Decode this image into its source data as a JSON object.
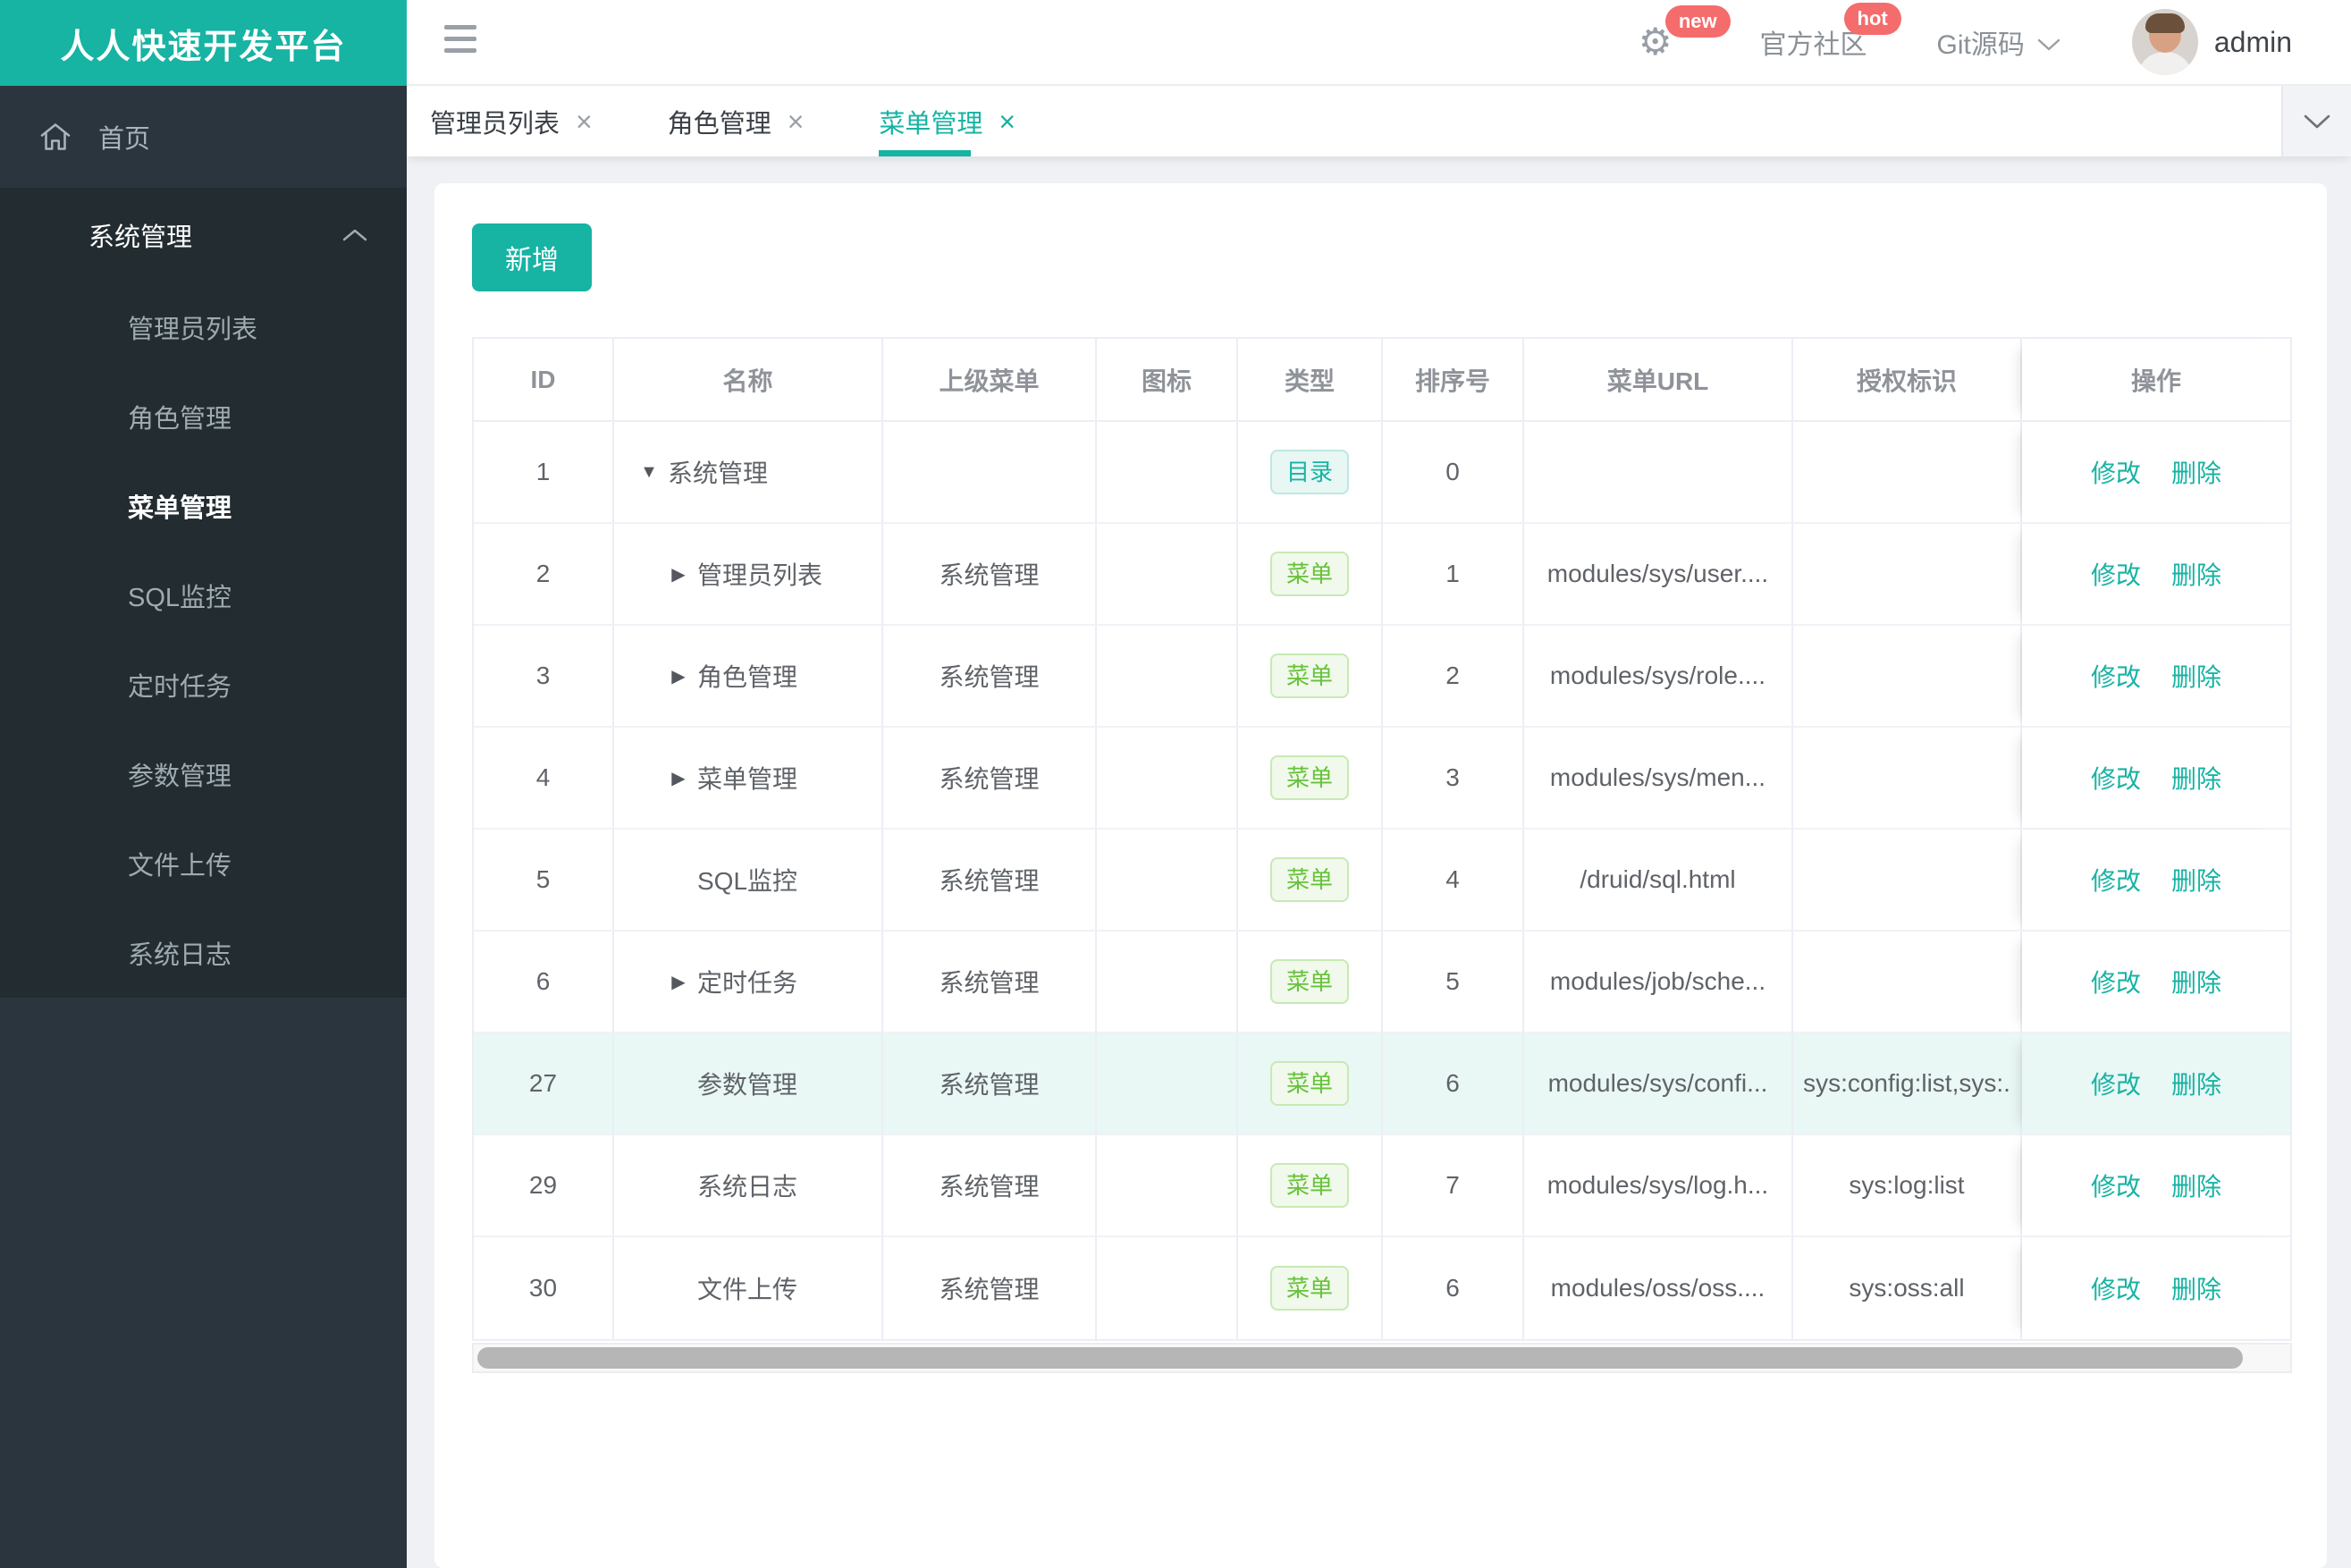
{
  "colors": {
    "accent": "#17b3a3",
    "badge_red": "#f56c6c",
    "dir_teal": "#17b3a3",
    "menu_green": "#67c23a",
    "highlight_row": "#e9f7f5"
  },
  "app": {
    "logo_title": "人人快速开发平台"
  },
  "topbar": {
    "gear_badge": "new",
    "community_label": "官方社区",
    "community_badge": "hot",
    "git_label": "Git源码",
    "username": "admin"
  },
  "sidebar": {
    "home_label": "首页",
    "group_label": "系统管理",
    "items": [
      {
        "label": "管理员列表",
        "active": false
      },
      {
        "label": "角色管理",
        "active": false
      },
      {
        "label": "菜单管理",
        "active": true
      },
      {
        "label": "SQL监控",
        "active": false
      },
      {
        "label": "定时任务",
        "active": false
      },
      {
        "label": "参数管理",
        "active": false
      },
      {
        "label": "文件上传",
        "active": false
      },
      {
        "label": "系统日志",
        "active": false
      }
    ]
  },
  "tabs": [
    {
      "label": "管理员列表",
      "close": "×",
      "active": false
    },
    {
      "label": "角色管理",
      "close": "×",
      "active": false
    },
    {
      "label": "菜单管理",
      "close": "×",
      "active": true
    }
  ],
  "toolbar": {
    "add_label": "新增"
  },
  "table": {
    "columns": [
      "ID",
      "名称",
      "上级菜单",
      "图标",
      "类型",
      "排序号",
      "菜单URL",
      "授权标识",
      "操作"
    ],
    "actions": {
      "edit": "修改",
      "delete": "删除"
    },
    "rows": [
      {
        "id": "1",
        "name": "系统管理",
        "arrow": "down",
        "indent": 0,
        "parent": "",
        "type": "目录",
        "type_kind": "dir",
        "order": "0",
        "url": "",
        "perm": "",
        "highlight": false
      },
      {
        "id": "2",
        "name": "管理员列表",
        "arrow": "right",
        "indent": 1,
        "parent": "系统管理",
        "type": "菜单",
        "type_kind": "menu",
        "order": "1",
        "url": "modules/sys/user....",
        "perm": "",
        "highlight": false
      },
      {
        "id": "3",
        "name": "角色管理",
        "arrow": "right",
        "indent": 1,
        "parent": "系统管理",
        "type": "菜单",
        "type_kind": "menu",
        "order": "2",
        "url": "modules/sys/role....",
        "perm": "",
        "highlight": false
      },
      {
        "id": "4",
        "name": "菜单管理",
        "arrow": "right",
        "indent": 1,
        "parent": "系统管理",
        "type": "菜单",
        "type_kind": "menu",
        "order": "3",
        "url": "modules/sys/men...",
        "perm": "",
        "highlight": false
      },
      {
        "id": "5",
        "name": "SQL监控",
        "arrow": "none",
        "indent": 1,
        "parent": "系统管理",
        "type": "菜单",
        "type_kind": "menu",
        "order": "4",
        "url": "/druid/sql.html",
        "perm": "",
        "highlight": false
      },
      {
        "id": "6",
        "name": "定时任务",
        "arrow": "right",
        "indent": 1,
        "parent": "系统管理",
        "type": "菜单",
        "type_kind": "menu",
        "order": "5",
        "url": "modules/job/sche...",
        "perm": "",
        "highlight": false
      },
      {
        "id": "27",
        "name": "参数管理",
        "arrow": "none",
        "indent": 1,
        "parent": "系统管理",
        "type": "菜单",
        "type_kind": "menu",
        "order": "6",
        "url": "modules/sys/confi...",
        "perm": "sys:config:list,sys:.",
        "highlight": true
      },
      {
        "id": "29",
        "name": "系统日志",
        "arrow": "none",
        "indent": 1,
        "parent": "系统管理",
        "type": "菜单",
        "type_kind": "menu",
        "order": "7",
        "url": "modules/sys/log.h...",
        "perm": "sys:log:list",
        "highlight": false
      },
      {
        "id": "30",
        "name": "文件上传",
        "arrow": "none",
        "indent": 1,
        "parent": "系统管理",
        "type": "菜单",
        "type_kind": "menu",
        "order": "6",
        "url": "modules/oss/oss....",
        "perm": "sys:oss:all",
        "highlight": false
      }
    ]
  }
}
